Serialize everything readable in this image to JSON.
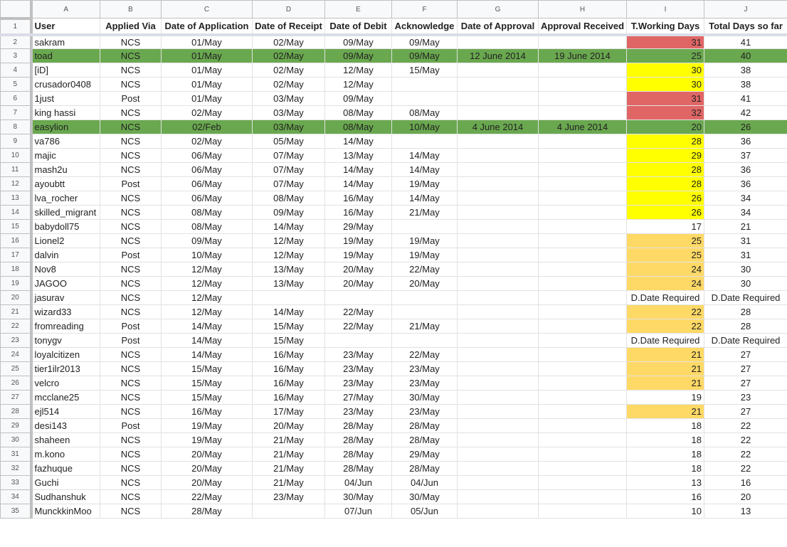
{
  "columns": [
    "A",
    "B",
    "C",
    "D",
    "E",
    "F",
    "G",
    "H",
    "I",
    "J"
  ],
  "headers": [
    "User",
    "Applied Via",
    "Date of Application",
    "Date of Receipt",
    "Date of Debit",
    "Acknowledge",
    "Date of Approval",
    "Approval Received",
    "T.Working Days",
    "Total Days so far"
  ],
  "colors": {
    "red": "#e06666",
    "orange": "#ffd966",
    "yellow": "#ffff00",
    "green": "#6aa84f"
  },
  "rows": [
    {
      "n": "2",
      "user": "sakram",
      "via": "NCS",
      "app": "01/May",
      "rec": "02/May",
      "deb": "09/May",
      "ack": "09/May",
      "appr": "",
      "recv": "",
      "twd": "31",
      "total": "41",
      "twd_color": "red"
    },
    {
      "n": "3",
      "user": "toad",
      "via": "NCS",
      "app": "01/May",
      "rec": "02/May",
      "deb": "09/May",
      "ack": "09/May",
      "appr": "12 June 2014",
      "recv": "19 June 2014",
      "twd": "25",
      "total": "40",
      "twd_color": "orange",
      "row_color": "green"
    },
    {
      "n": "4",
      "user": "[iD]",
      "via": "NCS",
      "app": "01/May",
      "rec": "02/May",
      "deb": "12/May",
      "ack": "15/May",
      "appr": "",
      "recv": "",
      "twd": "30",
      "total": "38",
      "twd_color": "yellow"
    },
    {
      "n": "5",
      "user": "crusador0408",
      "via": "NCS",
      "app": "01/May",
      "rec": "02/May",
      "deb": "12/May",
      "ack": "",
      "appr": "",
      "recv": "",
      "twd": "30",
      "total": "38",
      "twd_color": "yellow"
    },
    {
      "n": "6",
      "user": "1just",
      "via": "Post",
      "app": "01/May",
      "rec": "03/May",
      "deb": "09/May",
      "ack": "",
      "appr": "",
      "recv": "",
      "twd": "31",
      "total": "41",
      "twd_color": "red"
    },
    {
      "n": "7",
      "user": "king hassi",
      "via": "NCS",
      "app": "02/May",
      "rec": "03/May",
      "deb": "08/May",
      "ack": "08/May",
      "appr": "",
      "recv": "",
      "twd": "32",
      "total": "42",
      "twd_color": "red"
    },
    {
      "n": "8",
      "user": "easylion",
      "via": "NCS",
      "app": "02/Feb",
      "rec": "03/May",
      "deb": "08/May",
      "ack": "10/May",
      "appr": "4 June 2014",
      "recv": "4 June 2014",
      "twd": "20",
      "total": "26",
      "twd_color": "",
      "row_color": "green"
    },
    {
      "n": "9",
      "user": "va786",
      "via": "NCS",
      "app": "02/May",
      "rec": "05/May",
      "deb": "14/May",
      "ack": "",
      "appr": "",
      "recv": "",
      "twd": "28",
      "total": "36",
      "twd_color": "yellow"
    },
    {
      "n": "10",
      "user": "majic",
      "via": "NCS",
      "app": "06/May",
      "rec": "07/May",
      "deb": "13/May",
      "ack": "14/May",
      "appr": "",
      "recv": "",
      "twd": "29",
      "total": "37",
      "twd_color": "yellow"
    },
    {
      "n": "11",
      "user": "mash2u",
      "via": "NCS",
      "app": "06/May",
      "rec": "07/May",
      "deb": "14/May",
      "ack": "14/May",
      "appr": "",
      "recv": "",
      "twd": "28",
      "total": "36",
      "twd_color": "yellow"
    },
    {
      "n": "12",
      "user": "ayoubtt",
      "via": "Post",
      "app": "06/May",
      "rec": "07/May",
      "deb": "14/May",
      "ack": "19/May",
      "appr": "",
      "recv": "",
      "twd": "28",
      "total": "36",
      "twd_color": "yellow"
    },
    {
      "n": "13",
      "user": "lva_rocher",
      "via": "NCS",
      "app": "06/May",
      "rec": "08/May",
      "deb": "16/May",
      "ack": "14/May",
      "appr": "",
      "recv": "",
      "twd": "26",
      "total": "34",
      "twd_color": "yellow"
    },
    {
      "n": "14",
      "user": "skilled_migrant",
      "via": "NCS",
      "app": "08/May",
      "rec": "09/May",
      "deb": "16/May",
      "ack": "21/May",
      "appr": "",
      "recv": "",
      "twd": "26",
      "total": "34",
      "twd_color": "yellow"
    },
    {
      "n": "15",
      "user": "babydoll75",
      "via": "NCS",
      "app": "08/May",
      "rec": "14/May",
      "deb": "29/May",
      "ack": "",
      "appr": "",
      "recv": "",
      "twd": "17",
      "total": "21",
      "twd_color": ""
    },
    {
      "n": "16",
      "user": "Lionel2",
      "via": "NCS",
      "app": "09/May",
      "rec": "12/May",
      "deb": "19/May",
      "ack": "19/May",
      "appr": "",
      "recv": "",
      "twd": "25",
      "total": "31",
      "twd_color": "orange"
    },
    {
      "n": "17",
      "user": "dalvin",
      "via": "Post",
      "app": "10/May",
      "rec": "12/May",
      "deb": "19/May",
      "ack": "19/May",
      "appr": "",
      "recv": "",
      "twd": "25",
      "total": "31",
      "twd_color": "orange"
    },
    {
      "n": "18",
      "user": "Nov8",
      "via": "NCS",
      "app": "12/May",
      "rec": "13/May",
      "deb": "20/May",
      "ack": "22/May",
      "appr": "",
      "recv": "",
      "twd": "24",
      "total": "30",
      "twd_color": "orange"
    },
    {
      "n": "19",
      "user": "JAGOO",
      "via": "NCS",
      "app": "12/May",
      "rec": "13/May",
      "deb": "20/May",
      "ack": "20/May",
      "appr": "",
      "recv": "",
      "twd": "24",
      "total": "30",
      "twd_color": "orange"
    },
    {
      "n": "20",
      "user": "jasurav",
      "via": "NCS",
      "app": "12/May",
      "rec": "",
      "deb": "",
      "ack": "",
      "appr": "",
      "recv": "",
      "twd": "D.Date Required",
      "total": "D.Date Required",
      "twd_color": ""
    },
    {
      "n": "21",
      "user": "wizard33",
      "via": "NCS",
      "app": "12/May",
      "rec": "14/May",
      "deb": "22/May",
      "ack": "",
      "appr": "",
      "recv": "",
      "twd": "22",
      "total": "28",
      "twd_color": "orange"
    },
    {
      "n": "22",
      "user": "fromreading",
      "via": "Post",
      "app": "14/May",
      "rec": "15/May",
      "deb": "22/May",
      "ack": "21/May",
      "appr": "",
      "recv": "",
      "twd": "22",
      "total": "28",
      "twd_color": "orange"
    },
    {
      "n": "23",
      "user": "tonygv",
      "via": "Post",
      "app": "14/May",
      "rec": "15/May",
      "deb": "",
      "ack": "",
      "appr": "",
      "recv": "",
      "twd": "D.Date Required",
      "total": "D.Date Required",
      "twd_color": ""
    },
    {
      "n": "24",
      "user": "loyalcitizen",
      "via": "NCS",
      "app": "14/May",
      "rec": "16/May",
      "deb": "23/May",
      "ack": "22/May",
      "appr": "",
      "recv": "",
      "twd": "21",
      "total": "27",
      "twd_color": "orange"
    },
    {
      "n": "25",
      "user": "tier1ilr2013",
      "via": "NCS",
      "app": "15/May",
      "rec": "16/May",
      "deb": "23/May",
      "ack": "23/May",
      "appr": "",
      "recv": "",
      "twd": "21",
      "total": "27",
      "twd_color": "orange"
    },
    {
      "n": "26",
      "user": "velcro",
      "via": "NCS",
      "app": "15/May",
      "rec": "16/May",
      "deb": "23/May",
      "ack": "23/May",
      "appr": "",
      "recv": "",
      "twd": "21",
      "total": "27",
      "twd_color": "orange"
    },
    {
      "n": "27",
      "user": "mcclane25",
      "via": "NCS",
      "app": "15/May",
      "rec": "16/May",
      "deb": "27/May",
      "ack": "30/May",
      "appr": "",
      "recv": "",
      "twd": "19",
      "total": "23",
      "twd_color": ""
    },
    {
      "n": "28",
      "user": "ejl514",
      "via": "NCS",
      "app": "16/May",
      "rec": "17/May",
      "deb": "23/May",
      "ack": "23/May",
      "appr": "",
      "recv": "",
      "twd": "21",
      "total": "27",
      "twd_color": "orange"
    },
    {
      "n": "29",
      "user": "desi143",
      "via": "Post",
      "app": "19/May",
      "rec": "20/May",
      "deb": "28/May",
      "ack": "28/May",
      "appr": "",
      "recv": "",
      "twd": "18",
      "total": "22",
      "twd_color": ""
    },
    {
      "n": "30",
      "user": "shaheen",
      "via": "NCS",
      "app": "19/May",
      "rec": "21/May",
      "deb": "28/May",
      "ack": "28/May",
      "appr": "",
      "recv": "",
      "twd": "18",
      "total": "22",
      "twd_color": ""
    },
    {
      "n": "31",
      "user": "m.kono",
      "via": "NCS",
      "app": "20/May",
      "rec": "21/May",
      "deb": "28/May",
      "ack": "29/May",
      "appr": "",
      "recv": "",
      "twd": "18",
      "total": "22",
      "twd_color": ""
    },
    {
      "n": "32",
      "user": "fazhuque",
      "via": "NCS",
      "app": "20/May",
      "rec": "21/May",
      "deb": "28/May",
      "ack": "28/May",
      "appr": "",
      "recv": "",
      "twd": "18",
      "total": "22",
      "twd_color": ""
    },
    {
      "n": "33",
      "user": "Guchi",
      "via": "NCS",
      "app": "20/May",
      "rec": "21/May",
      "deb": "04/Jun",
      "ack": "04/Jun",
      "appr": "",
      "recv": "",
      "twd": "13",
      "total": "16",
      "twd_color": ""
    },
    {
      "n": "34",
      "user": "Sudhanshuk",
      "via": "NCS",
      "app": "22/May",
      "rec": "23/May",
      "deb": "30/May",
      "ack": "30/May",
      "appr": "",
      "recv": "",
      "twd": "16",
      "total": "20",
      "twd_color": ""
    },
    {
      "n": "35",
      "user": "MunckkinMoo",
      "via": "NCS",
      "app": "28/May",
      "rec": "",
      "deb": "07/Jun",
      "ack": "05/Jun",
      "appr": "",
      "recv": "",
      "twd": "10",
      "total": "13",
      "twd_color": ""
    }
  ]
}
